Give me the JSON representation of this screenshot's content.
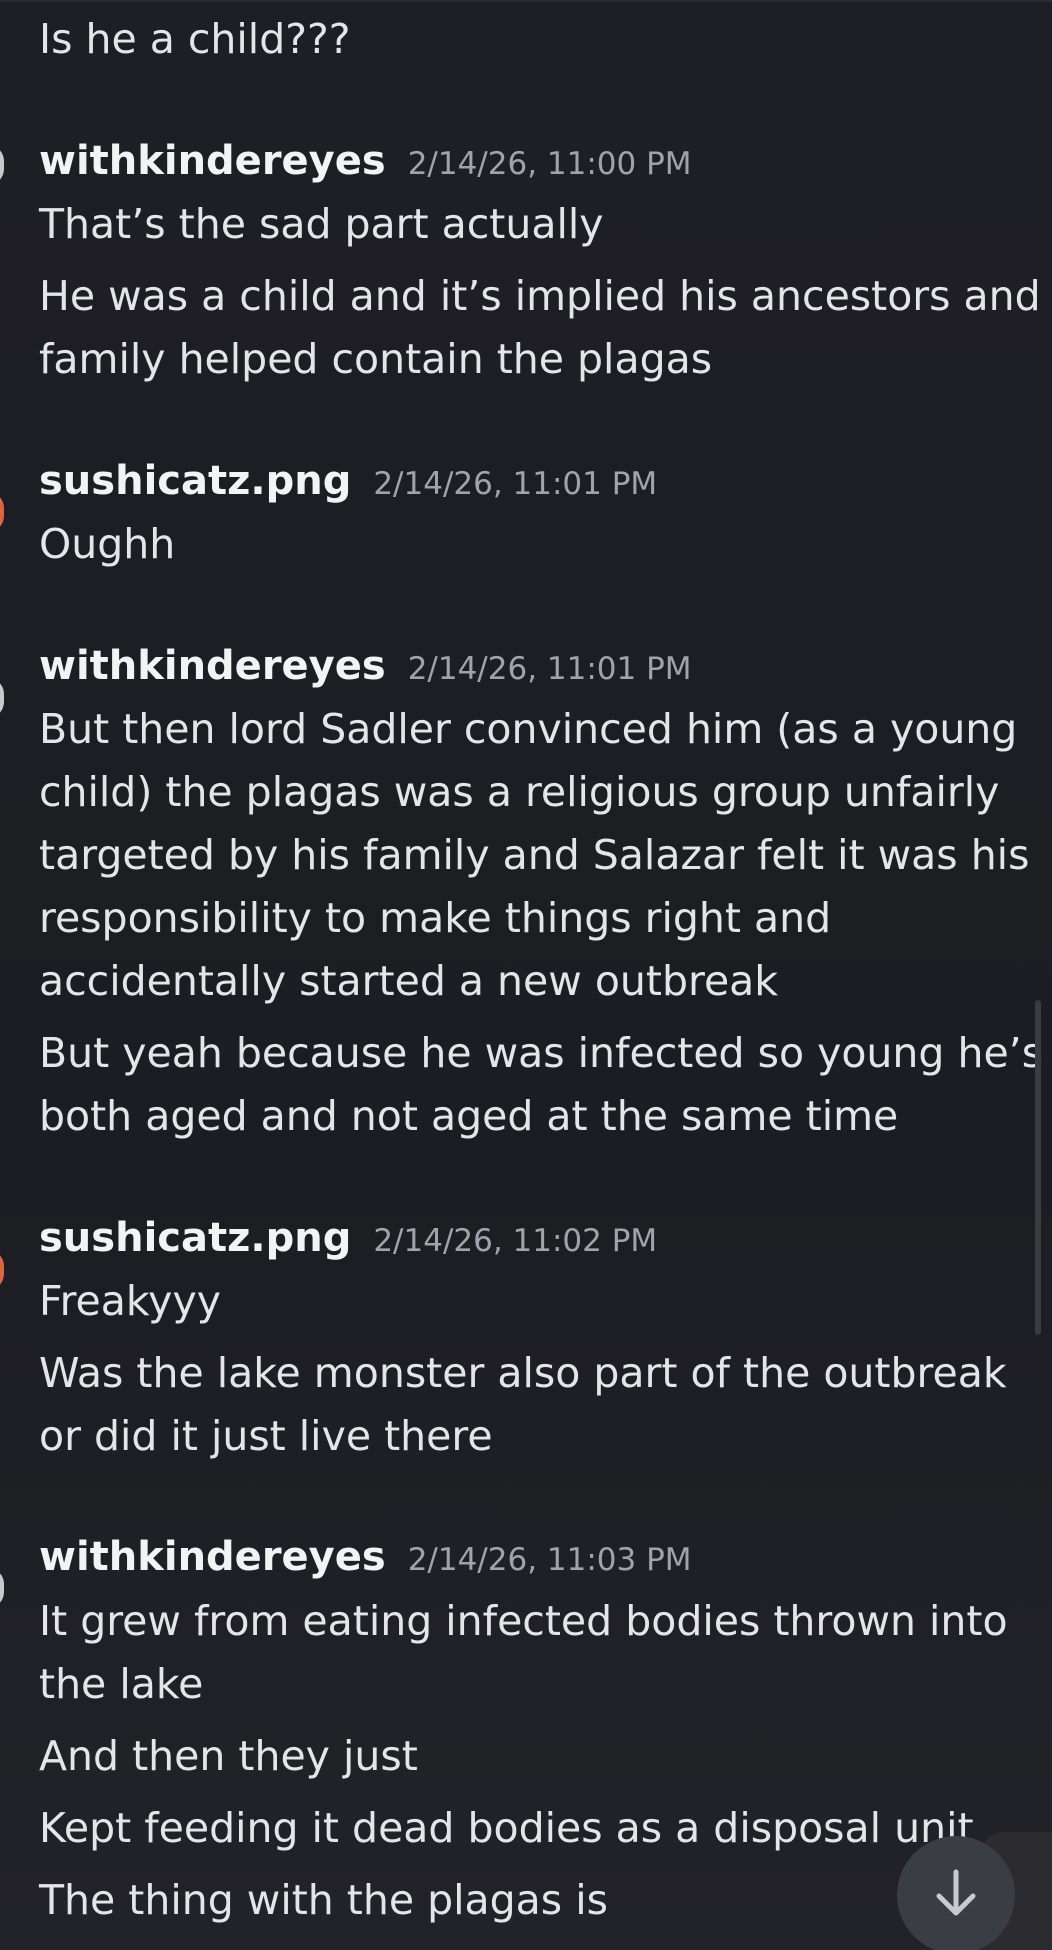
{
  "messages": {
    "m0": {
      "lines": [
        "Is he a child???"
      ]
    },
    "m1": {
      "author": "withkindereyes",
      "timestamp": "2/14/26, 11:00 PM",
      "lines": [
        "That’s the sad part actually",
        "He was a child and it’s implied his ancestors and",
        "family helped contain the plagas"
      ]
    },
    "m2": {
      "author": "sushicatz.png",
      "timestamp": "2/14/26, 11:01 PM",
      "lines": [
        "Oughh"
      ]
    },
    "m3": {
      "author": "withkindereyes",
      "timestamp": "2/14/26, 11:01 PM",
      "lines": [
        "But then lord Sadler convinced him (as a young",
        "child) the plagas was a religious group unfairly",
        "targeted by his family and Salazar felt it was his",
        "responsibility to make things right and",
        "accidentally started a new outbreak",
        "But yeah because he was infected so young he’s",
        "both aged and not aged at the same time"
      ]
    },
    "m4": {
      "author": "sushicatz.png",
      "timestamp": "2/14/26, 11:02 PM",
      "lines": [
        "Freakyyy",
        "Was the lake monster also part of the outbreak",
        "or did it just live there"
      ]
    },
    "m5": {
      "author": "withkindereyes",
      "timestamp": "2/14/26, 11:03 PM",
      "lines": [
        "It grew from eating infected bodies thrown into",
        "the lake",
        "And then they just",
        "Kept feeding it dead bodies as a disposal unit",
        "The thing with the plagas is"
      ]
    }
  },
  "icons": {
    "jump_to_latest": "arrow-down-icon"
  },
  "colors": {
    "background": "#1c1d22",
    "message_text": "#e3e5e8",
    "username": "#f2f3f5",
    "timestamp": "#a0a3ab",
    "jump_button": "#3b3d44",
    "sushicatz_avatar_accent": "#e0643c",
    "withkindereyes_avatar_accent": "#c9c9c9"
  }
}
